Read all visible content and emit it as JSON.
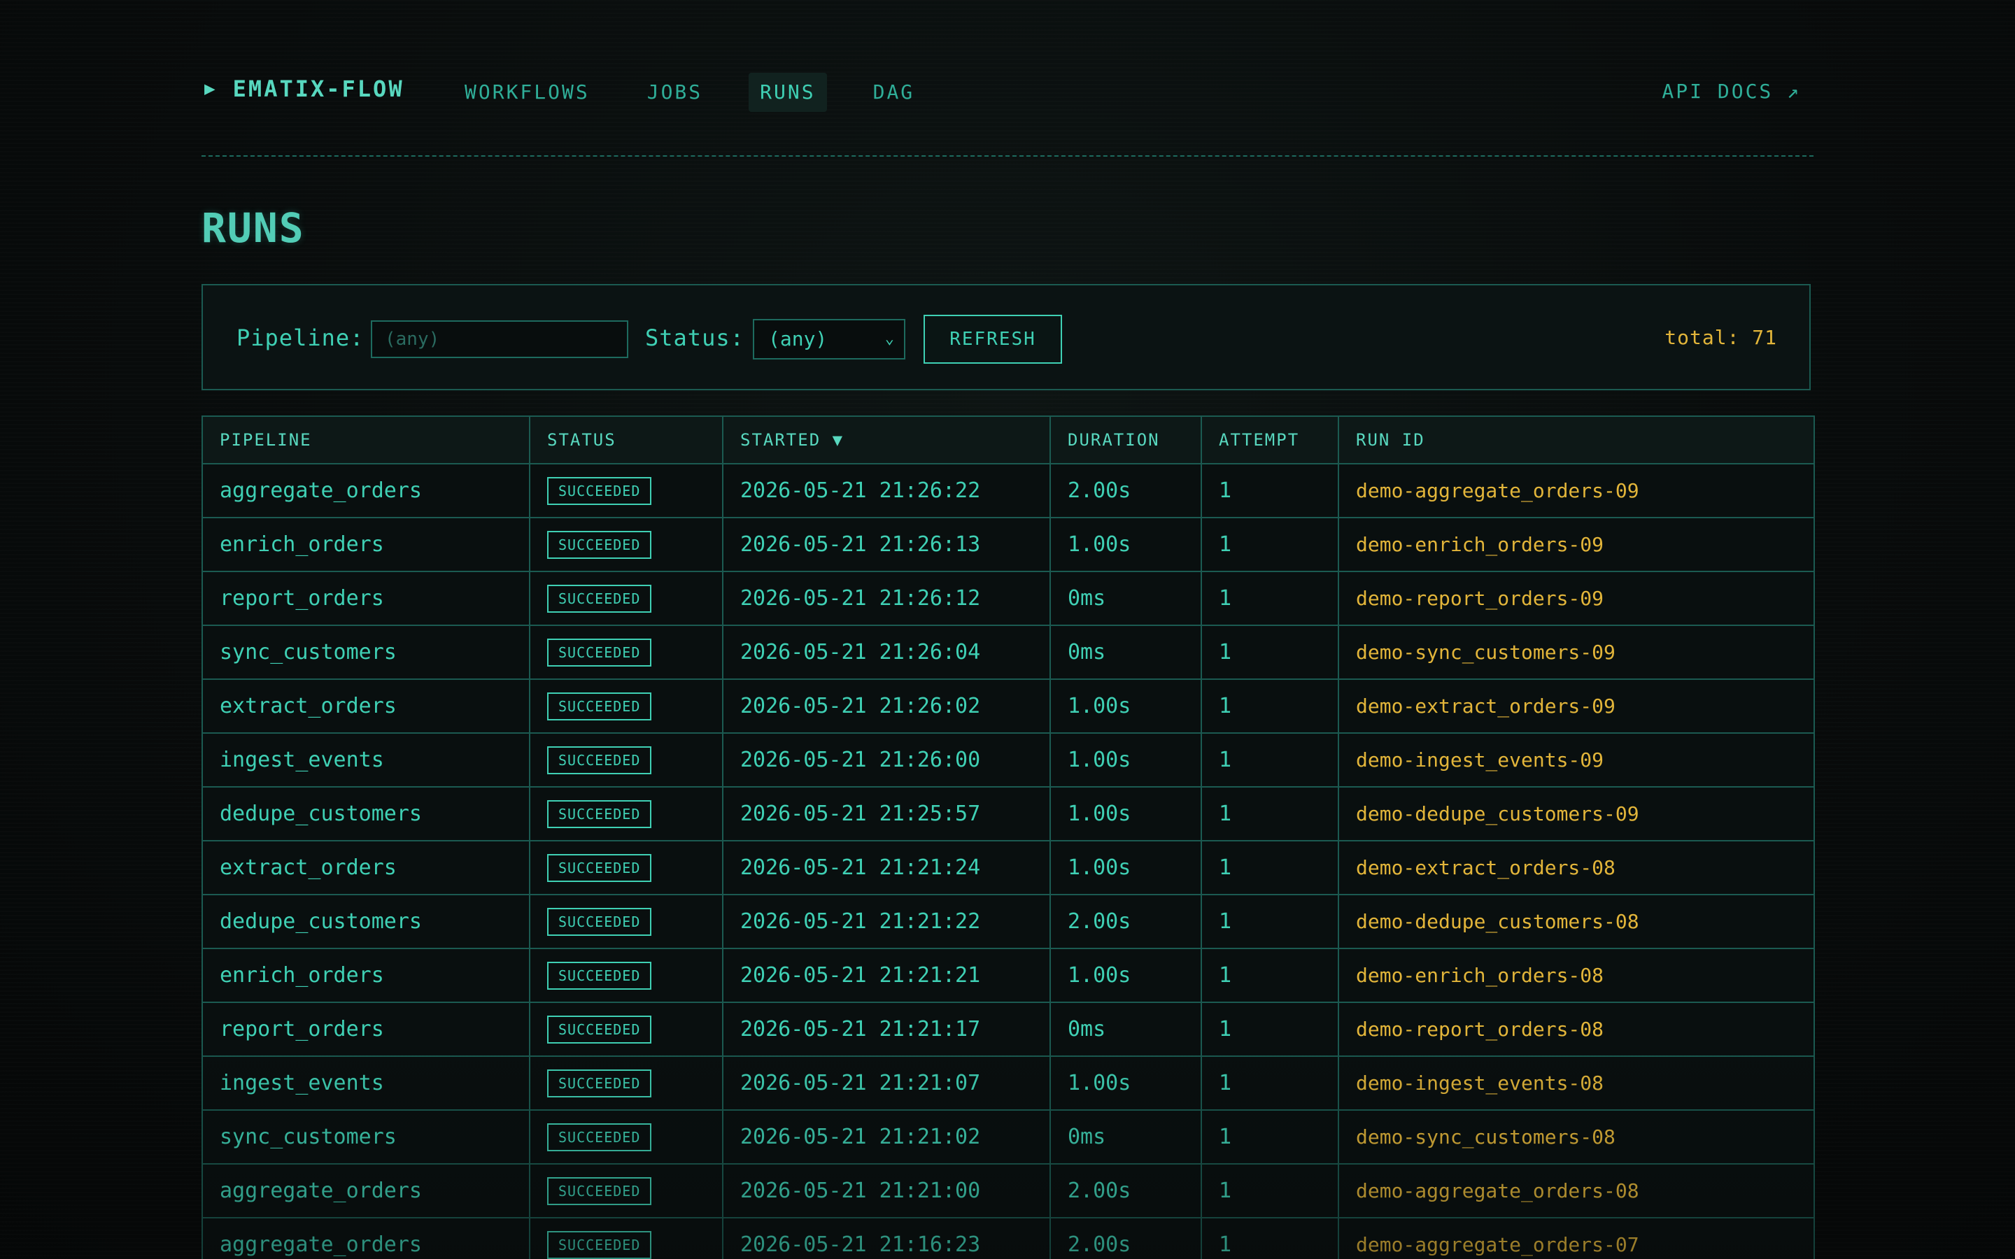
{
  "brand": {
    "icon": "play-icon",
    "name": "EMATIX-FLOW"
  },
  "nav": {
    "links": [
      {
        "label": "WORKFLOWS",
        "active": false
      },
      {
        "label": "JOBS",
        "active": false
      },
      {
        "label": "RUNS",
        "active": true
      },
      {
        "label": "DAG",
        "active": false
      }
    ],
    "api_docs": "API DOCS ↗"
  },
  "page": {
    "title": "RUNS"
  },
  "filters": {
    "pipeline_label": "Pipeline:",
    "pipeline_value": "",
    "pipeline_placeholder": "(any)",
    "status_label": "Status:",
    "status_value": "(any)",
    "refresh_label": "REFRESH",
    "total": "total: 71"
  },
  "table": {
    "columns": [
      "PIPELINE",
      "STATUS",
      "STARTED ▼",
      "DURATION",
      "ATTEMPT",
      "RUN ID"
    ],
    "rows": [
      {
        "pipeline": "aggregate_orders",
        "status": "SUCCEEDED",
        "started": "2026-05-21 21:26:22",
        "duration": "2.00s",
        "attempt": "1",
        "run_id": "demo-aggregate_orders-09"
      },
      {
        "pipeline": "enrich_orders",
        "status": "SUCCEEDED",
        "started": "2026-05-21 21:26:13",
        "duration": "1.00s",
        "attempt": "1",
        "run_id": "demo-enrich_orders-09"
      },
      {
        "pipeline": "report_orders",
        "status": "SUCCEEDED",
        "started": "2026-05-21 21:26:12",
        "duration": "0ms",
        "attempt": "1",
        "run_id": "demo-report_orders-09"
      },
      {
        "pipeline": "sync_customers",
        "status": "SUCCEEDED",
        "started": "2026-05-21 21:26:04",
        "duration": "0ms",
        "attempt": "1",
        "run_id": "demo-sync_customers-09"
      },
      {
        "pipeline": "extract_orders",
        "status": "SUCCEEDED",
        "started": "2026-05-21 21:26:02",
        "duration": "1.00s",
        "attempt": "1",
        "run_id": "demo-extract_orders-09"
      },
      {
        "pipeline": "ingest_events",
        "status": "SUCCEEDED",
        "started": "2026-05-21 21:26:00",
        "duration": "1.00s",
        "attempt": "1",
        "run_id": "demo-ingest_events-09"
      },
      {
        "pipeline": "dedupe_customers",
        "status": "SUCCEEDED",
        "started": "2026-05-21 21:25:57",
        "duration": "1.00s",
        "attempt": "1",
        "run_id": "demo-dedupe_customers-09"
      },
      {
        "pipeline": "extract_orders",
        "status": "SUCCEEDED",
        "started": "2026-05-21 21:21:24",
        "duration": "1.00s",
        "attempt": "1",
        "run_id": "demo-extract_orders-08"
      },
      {
        "pipeline": "dedupe_customers",
        "status": "SUCCEEDED",
        "started": "2026-05-21 21:21:22",
        "duration": "2.00s",
        "attempt": "1",
        "run_id": "demo-dedupe_customers-08"
      },
      {
        "pipeline": "enrich_orders",
        "status": "SUCCEEDED",
        "started": "2026-05-21 21:21:21",
        "duration": "1.00s",
        "attempt": "1",
        "run_id": "demo-enrich_orders-08"
      },
      {
        "pipeline": "report_orders",
        "status": "SUCCEEDED",
        "started": "2026-05-21 21:21:17",
        "duration": "0ms",
        "attempt": "1",
        "run_id": "demo-report_orders-08"
      },
      {
        "pipeline": "ingest_events",
        "status": "SUCCEEDED",
        "started": "2026-05-21 21:21:07",
        "duration": "1.00s",
        "attempt": "1",
        "run_id": "demo-ingest_events-08"
      },
      {
        "pipeline": "sync_customers",
        "status": "SUCCEEDED",
        "started": "2026-05-21 21:21:02",
        "duration": "0ms",
        "attempt": "1",
        "run_id": "demo-sync_customers-08"
      },
      {
        "pipeline": "aggregate_orders",
        "status": "SUCCEEDED",
        "started": "2026-05-21 21:21:00",
        "duration": "2.00s",
        "attempt": "1",
        "run_id": "demo-aggregate_orders-08"
      },
      {
        "pipeline": "aggregate_orders",
        "status": "SUCCEEDED",
        "started": "2026-05-21 21:16:23",
        "duration": "2.00s",
        "attempt": "1",
        "run_id": "demo-aggregate_orders-07"
      }
    ]
  },
  "colors": {
    "accent": "#3fd0b4",
    "highlight": "#e2b53a",
    "border": "#1b5a51",
    "background": "#070909"
  }
}
